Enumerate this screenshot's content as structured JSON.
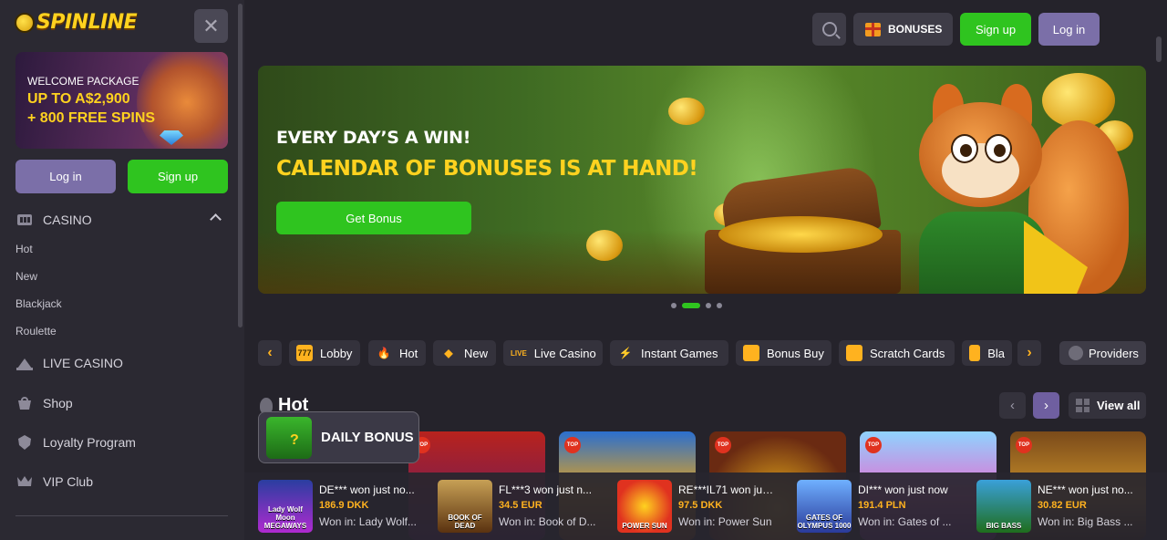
{
  "brand": {
    "logo_text": "SPINLINE"
  },
  "sidebar": {
    "promo": {
      "line1": "WELCOME PACKAGE",
      "line2": "UP TO A$2,900",
      "line3": "+ 800 FREE SPINS"
    },
    "login_label": "Log in",
    "signup_label": "Sign up",
    "casino_label": "CASINO",
    "casino_sub": [
      "Hot",
      "New",
      "Blackjack",
      "Roulette"
    ],
    "items": [
      {
        "label": "LIVE CASINO",
        "icon": "live-casino-icon"
      },
      {
        "label": "Shop",
        "icon": "shop-icon"
      },
      {
        "label": "Loyalty Program",
        "icon": "loyalty-icon"
      },
      {
        "label": "VIP Club",
        "icon": "crown-icon"
      }
    ]
  },
  "header": {
    "bonuses_label": "BONUSES",
    "signup_label": "Sign up",
    "login_label": "Log in"
  },
  "banner": {
    "line1": "EVERY DAY’S A WIN!",
    "line2": "CALENDAR OF BONUSES IS AT HAND!",
    "button": "Get Bonus",
    "slides": 4,
    "active_slide": 2
  },
  "categories": [
    "Lobby",
    "Hot",
    "New",
    "Live Casino",
    "Instant Games",
    "Bonus Buy",
    "Scratch Cards",
    "Bla"
  ],
  "providers_label": "Providers",
  "hot": {
    "title": "Hot",
    "view_all": "View all",
    "badge": "TOP"
  },
  "daily_bonus": "DAILY BONUS",
  "winners": [
    {
      "who": "DE*** won just no...",
      "amount": "186.9 DKK",
      "game": "Won in: Lady Wolf...",
      "thumb": "Lady Wolf Moon MEGAWAYS"
    },
    {
      "who": "FL***3 won just n...",
      "amount": "34.5 EUR",
      "game": "Won in: Book of D...",
      "thumb": "BOOK OF DEAD"
    },
    {
      "who": "RE***IL71 won just...",
      "amount": "97.5 DKK",
      "game": "Won in: Power Sun",
      "thumb": "POWER SUN"
    },
    {
      "who": "DI*** won just now",
      "amount": "191.4 PLN",
      "game": "Won in: Gates of ...",
      "thumb": "GATES OF OLYMPUS 1000"
    },
    {
      "who": "NE*** won just no...",
      "amount": "30.82 EUR",
      "game": "Won in: Big Bass ...",
      "thumb": "BIG BASS"
    }
  ],
  "colors": {
    "green": "#2fc41f",
    "purple": "#7b6fa8",
    "gold": "#ffd21f",
    "orange": "#ffb21f",
    "bg": "#25232b",
    "sidebar": "#2b2932"
  }
}
